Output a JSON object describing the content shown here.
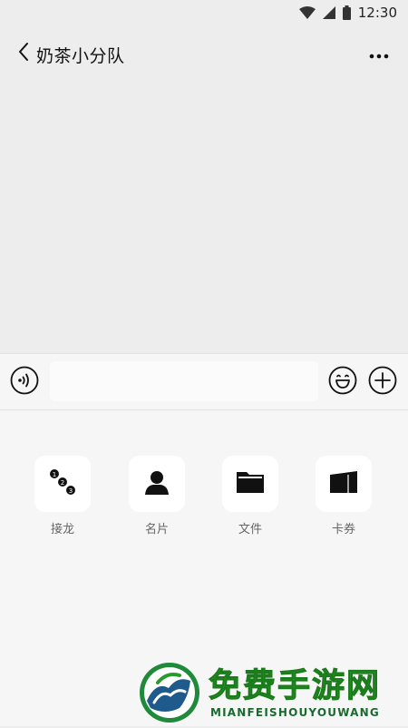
{
  "status_bar": {
    "time": "12:30",
    "icons": [
      "wifi-icon",
      "signal-icon",
      "battery-icon"
    ]
  },
  "header": {
    "title": "奶茶小分队",
    "back_icon": "chevron-left-icon",
    "more_icon": "more-dots-icon"
  },
  "input_bar": {
    "value": "",
    "placeholder": "",
    "left_icon": "voice-icon",
    "right_icons": [
      "emoji-icon",
      "plus-icon"
    ]
  },
  "tools": [
    {
      "label": "接龙",
      "icon": "numbered-list-icon"
    },
    {
      "label": "名片",
      "icon": "contact-card-icon"
    },
    {
      "label": "文件",
      "icon": "folder-icon"
    },
    {
      "label": "卡券",
      "icon": "coupon-icon"
    }
  ],
  "watermark": {
    "title": "免费手游网",
    "subtitle": "MIANFEISHOUYOUWANG"
  },
  "colors": {
    "background": "#ededed",
    "panel": "#f6f6f6",
    "watermark_green": "#2a9a2a"
  }
}
